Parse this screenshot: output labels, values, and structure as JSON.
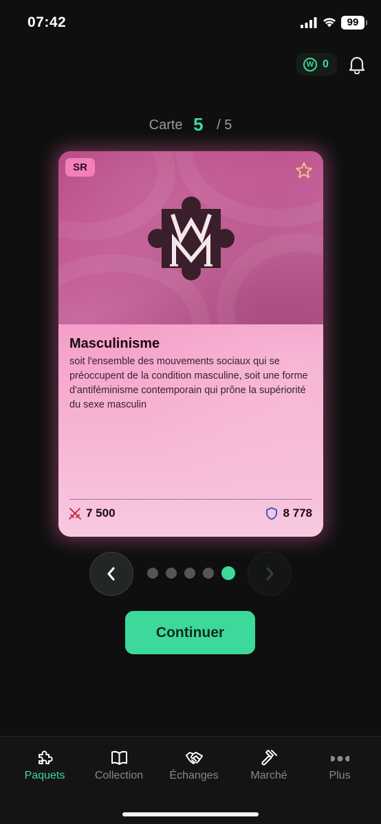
{
  "status_bar": {
    "time": "07:42",
    "battery": "99"
  },
  "header": {
    "coin_count": "0",
    "coin_symbol": "W"
  },
  "counter": {
    "label": "Carte",
    "current": "5",
    "total": "/ 5"
  },
  "card": {
    "rarity": "SR",
    "name": "Masculinisme",
    "description": "soit l'ensemble des mouvements sociaux qui se préoccupent de la condition masculine, soit une forme d'antiféminisme contemporain qui prône la supériorité du sexe masculin",
    "attack": "7 500",
    "defense": "8 778"
  },
  "pager": {
    "total_pages": 5,
    "current_page": 5
  },
  "continue_label": "Continuer",
  "tabs": [
    {
      "label": "Paquets",
      "icon": "puzzle-icon",
      "active": true
    },
    {
      "label": "Collection",
      "icon": "book-icon",
      "active": false
    },
    {
      "label": "Échanges",
      "icon": "handshake-icon",
      "active": false
    },
    {
      "label": "Marché",
      "icon": "gavel-icon",
      "active": false
    },
    {
      "label": "Plus",
      "icon": "more-icon",
      "active": false
    }
  ],
  "colors": {
    "accent": "#3dd99a",
    "card_pink": "#f59fc9",
    "rarity_badge": "#f47fb7",
    "background": "#0f0f0f"
  }
}
